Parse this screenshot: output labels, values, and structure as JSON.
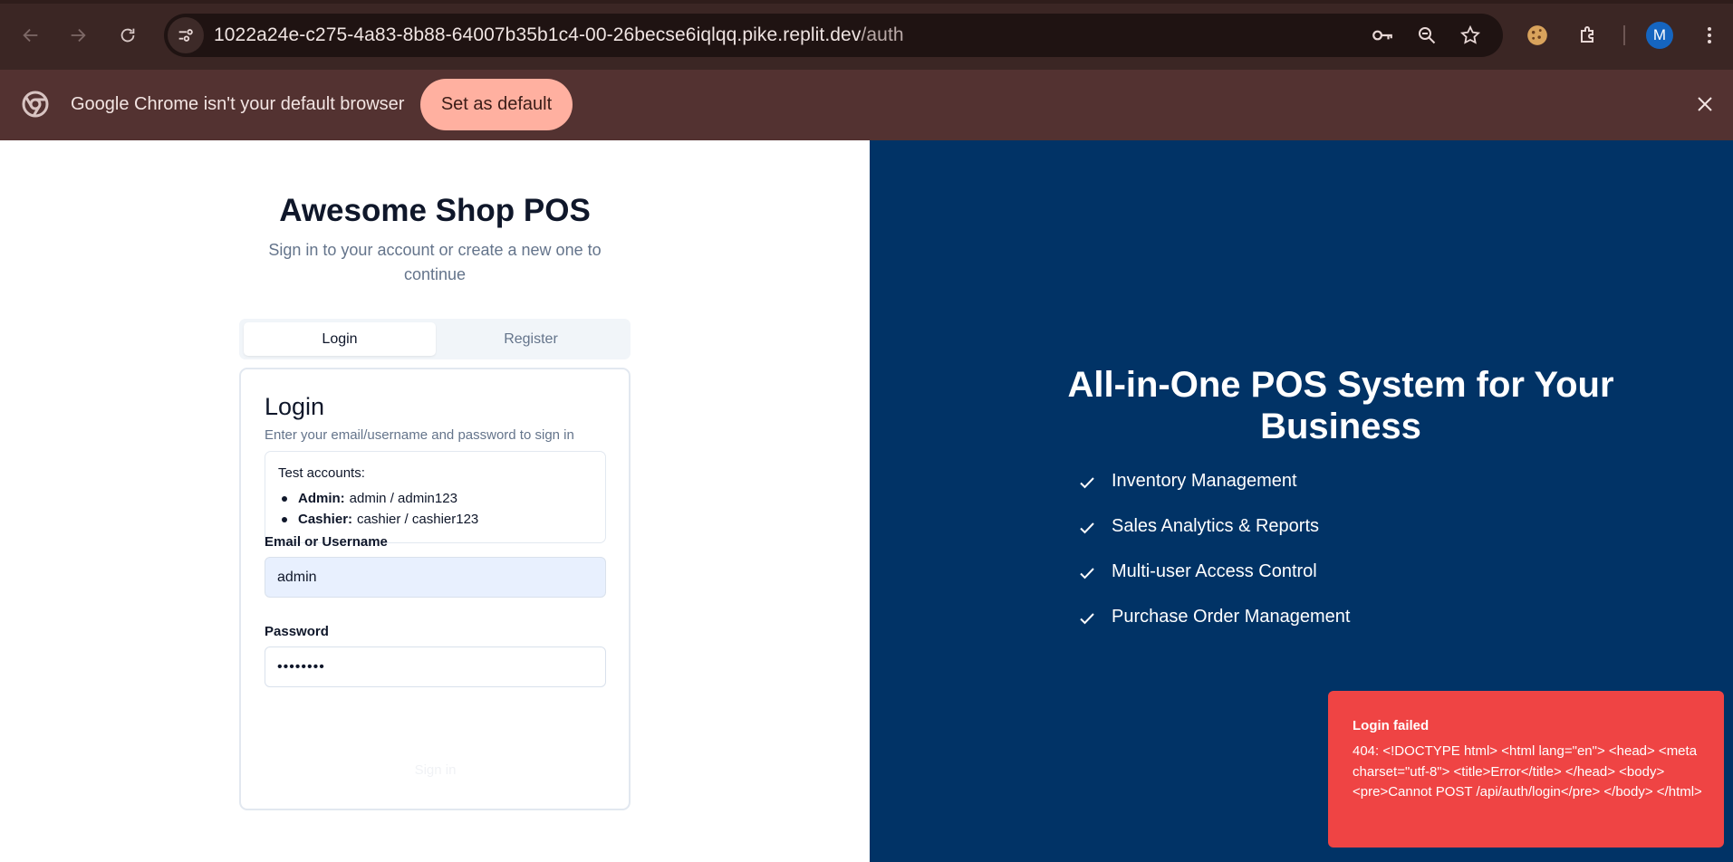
{
  "browser": {
    "url_host": "1022a24e-c275-4a83-8b88-64007b35b1c4-00-26becse6iqlqq.pike.replit.dev",
    "url_path": "/auth",
    "avatar_initial": "M",
    "icons": [
      "back-icon",
      "forward-icon",
      "reload-icon",
      "site-info-icon",
      "key-icon",
      "zoom-icon",
      "star-icon",
      "cookie-icon",
      "extensions-icon",
      "menu-icon"
    ]
  },
  "infobar": {
    "message": "Google Chrome isn't your default browser",
    "button_label": "Set as default"
  },
  "login_page": {
    "brand": "Awesome Shop POS",
    "subtitle": "Sign in to your account or create a new one to continue",
    "tabs": [
      {
        "label": "Login",
        "active": true
      },
      {
        "label": "Register",
        "active": false
      }
    ],
    "card": {
      "title": "Login",
      "description": "Enter your email/username and password to sign in",
      "test_accounts": {
        "heading": "Test accounts:",
        "items": [
          {
            "role": "Admin:",
            "creds": "admin / admin123"
          },
          {
            "role": "Cashier:",
            "creds": "cashier / cashier123"
          }
        ]
      },
      "username_label": "Email or Username",
      "username_value": "admin",
      "password_label": "Password",
      "password_value": "••••••••",
      "submit_label": "Sign in"
    }
  },
  "hero": {
    "title": "All-in-One POS System for Your Business",
    "features": [
      "Inventory Management",
      "Sales Analytics & Reports",
      "Multi-user Access Control",
      "Purchase Order Management"
    ]
  },
  "toast": {
    "title": "Login failed",
    "message": "404: <!DOCTYPE html> <html lang=\"en\"> <head> <meta charset=\"utf-8\"> <title>Error</title> </head> <body> <pre>Cannot POST /api/auth/login</pre> </body> </html>"
  },
  "colors": {
    "toolbar": "#3b2624",
    "infobar": "#533231",
    "hero_bg": "#013366",
    "toast_bg": "#ef4444",
    "set_default_bg": "#ffb0a0"
  }
}
